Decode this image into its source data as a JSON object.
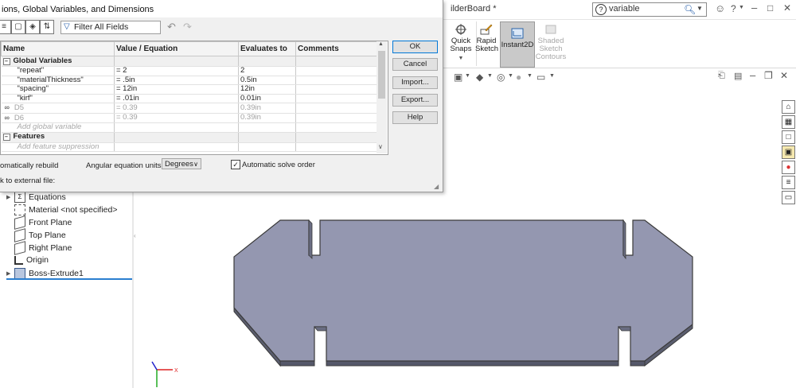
{
  "app": {
    "doc_title": "ilderBoard *",
    "search": {
      "value": "variable"
    },
    "window_controls": [
      "?",
      "–",
      "□",
      "✕"
    ]
  },
  "ribbon": {
    "buttons": [
      {
        "label": "Quick Snaps"
      },
      {
        "label": "Rapid Sketch"
      },
      {
        "label": "Instant2D",
        "active": true
      },
      {
        "label": "Shaded Sketch Contours",
        "disabled": true
      }
    ]
  },
  "dialog": {
    "title": "ions, Global Variables, and Dimensions",
    "filter_placeholder": "Filter All Fields",
    "columns": [
      "Name",
      "Value / Equation",
      "Evaluates to",
      "Comments"
    ],
    "sections": {
      "global_variables": "Global Variables",
      "features": "Features"
    },
    "rows": [
      {
        "name": "\"repeat\"",
        "value": "= 2",
        "evaluates": "2",
        "comment": ""
      },
      {
        "name": "\"materialThickness\"",
        "value": "= .5in",
        "evaluates": "0.5in",
        "comment": ""
      },
      {
        "name": "\"spacing\"",
        "value": "= 12in",
        "evaluates": "12in",
        "comment": ""
      },
      {
        "name": "\"kirf\"",
        "value": "= .01in",
        "evaluates": "0.01in",
        "comment": ""
      },
      {
        "name": "D5",
        "value": "= 0.39",
        "evaluates": "0.39in",
        "comment": "",
        "linked": true
      },
      {
        "name": "D6",
        "value": "= 0.39",
        "evaluates": "0.39in",
        "comment": "",
        "linked": true
      }
    ],
    "add_global_variable": "Add global variable",
    "add_feature_suppression": "Add feature suppression",
    "buttons": {
      "ok": "OK",
      "cancel": "Cancel",
      "import": "Import...",
      "export": "Export...",
      "help": "Help"
    },
    "auto_rebuild_label": "omatically rebuild",
    "angular_units_label": "Angular equation units:",
    "angular_units_value": "Degrees",
    "auto_solve_label": "Automatic solve order",
    "auto_solve_checked": true,
    "link_external_label": "k to external file:"
  },
  "tree": {
    "items": [
      {
        "label": "Equations",
        "expandable": true
      },
      {
        "label": "Material <not specified>"
      },
      {
        "label": "Front Plane"
      },
      {
        "label": "Top Plane"
      },
      {
        "label": "Right Plane"
      },
      {
        "label": "Origin"
      },
      {
        "label": "Boss-Extrude1",
        "expandable": true
      }
    ]
  },
  "colors": {
    "part_face": "#9497b0",
    "part_edge": "#3a3a3a",
    "selection_blue": "#2b7fd0",
    "ok_border": "#0078d7"
  }
}
